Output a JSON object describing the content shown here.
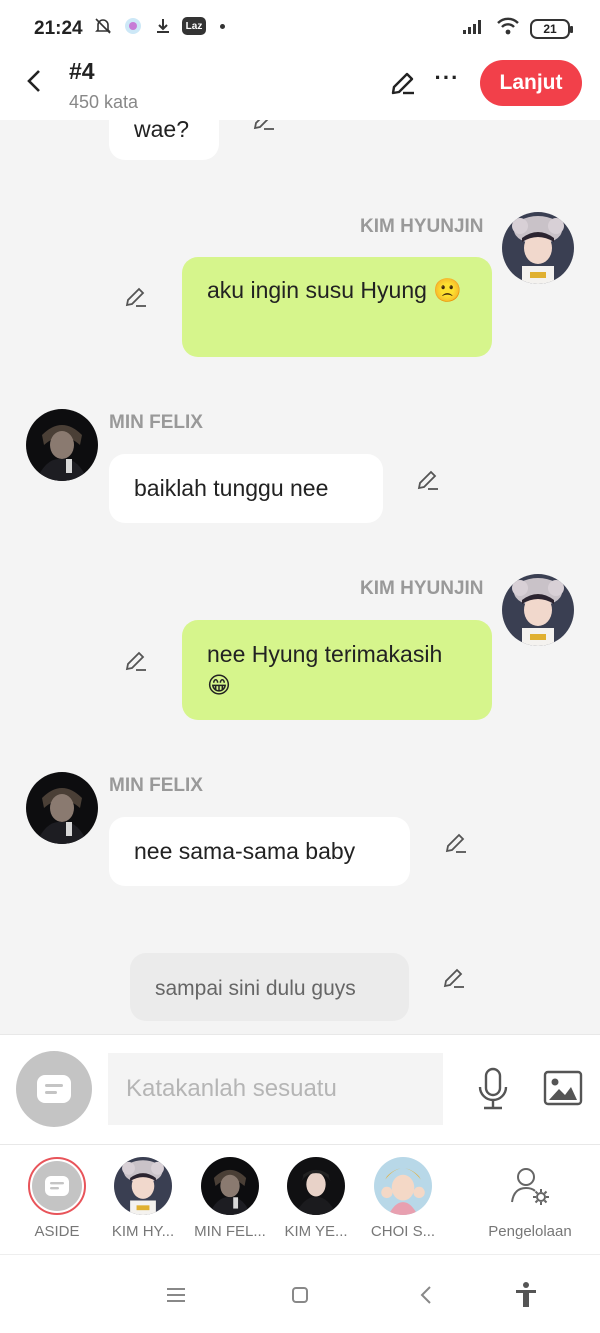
{
  "status_bar": {
    "time": "21:24",
    "app_badge": "Laz",
    "battery": "21"
  },
  "header": {
    "title": "#4",
    "subtitle": "450 kata",
    "next_label": "Lanjut"
  },
  "chat": {
    "partial_message": "wae?",
    "messages": [
      {
        "speaker": "KIM HYUNJIN",
        "side": "right",
        "text": "aku ingin susu Hyung 🙁"
      },
      {
        "speaker": "MIN FELIX",
        "side": "left",
        "text": "baiklah tunggu nee"
      },
      {
        "speaker": "KIM HYUNJIN",
        "side": "right",
        "text": "nee Hyung terimakasih 😁"
      },
      {
        "speaker": "MIN FELIX",
        "side": "left",
        "text": "nee sama-sama baby"
      },
      {
        "speaker": "ASIDE",
        "side": "center",
        "text": "sampai sini dulu guys"
      }
    ]
  },
  "input": {
    "placeholder": "Katakanlah sesuatu"
  },
  "characters": [
    {
      "label": "ASIDE",
      "selected": true
    },
    {
      "label": "KIM HY..."
    },
    {
      "label": "MIN FEL..."
    },
    {
      "label": "KIM YE..."
    },
    {
      "label": "CHOI S..."
    }
  ],
  "manage_label": "Pengelolaan",
  "colors": {
    "accent": "#f2404a",
    "right_bubble": "#d6f58c",
    "left_bubble": "#ffffff",
    "background": "#f4f4f4"
  }
}
